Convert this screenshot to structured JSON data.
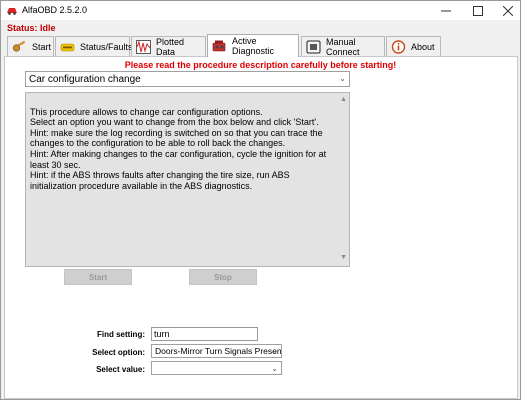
{
  "window": {
    "title": "AlfaOBD 2.5.2.0",
    "min_icon": "minimize-icon",
    "max_icon": "maximize-icon",
    "close_icon": "close-icon"
  },
  "status": "Status: Idle",
  "tabs": [
    {
      "label": "Start",
      "icon": "key-icon"
    },
    {
      "label": "Status/Faults",
      "icon": "fault-badge-icon"
    },
    {
      "label": "Plotted Data",
      "icon": "waveform-icon"
    },
    {
      "label": "Active Diagnostic",
      "icon": "engine-icon",
      "active": true
    },
    {
      "label": "Manual Connect",
      "icon": "connect-icon"
    },
    {
      "label": "About",
      "icon": "info-icon"
    }
  ],
  "warning": "Please read the procedure description carefully before starting!",
  "procedure": {
    "selected": "Car configuration change"
  },
  "description": "This procedure allows to change car configuration options.\nSelect an option you want to change from the box below and click 'Start'.\nHint: make sure the log recording is switched on so that you can trace the changes to the configuration to be able to roll back the changes.\nHint: After making changes to the car configuration, cycle the ignition for at least 30 sec.\nHint: if the ABS throws faults after changing the tire size, run ABS initialization procedure available in the ABS diagnostics.",
  "buttons": {
    "start": "Start",
    "stop": "Stop"
  },
  "find_setting": {
    "label": "Find setting:",
    "value": "turn"
  },
  "select_option": {
    "label": "Select option:",
    "value": "Doors-Mirror Turn Signals Presen"
  },
  "select_value": {
    "label": "Select value:",
    "value": ""
  },
  "colors": {
    "status": "#c00000",
    "warning": "#e00000",
    "description_bg": "#e3e3e3"
  }
}
